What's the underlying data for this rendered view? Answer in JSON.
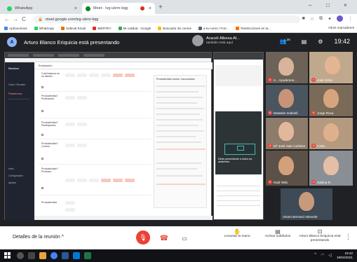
{
  "browser": {
    "tabs": [
      {
        "label": "WhatsApp",
        "favicon_color": "#25d366"
      },
      {
        "label": "Meet - Ivg-ukmr-kqg",
        "favicon_color": "#00832d"
      }
    ],
    "new_tab": "+",
    "window_controls": [
      "–",
      "□",
      "×"
    ],
    "url": "meet.google.com/ivg-ukmr-kqg",
    "nav": [
      "←",
      "→",
      "C"
    ],
    "bookmarks": [
      {
        "label": "Aplicaciones",
        "color": "#4285f4"
      },
      {
        "label": "WhatsApp",
        "color": "#25d366"
      },
      {
        "label": "Safeval Email",
        "color": "#e37400"
      },
      {
        "label": "WERTEY",
        "color": "#d93025"
      },
      {
        "label": "Mi calidad - Google",
        "color": "#34a853"
      },
      {
        "label": "Buscador de cursos",
        "color": "#fbbc04"
      },
      {
        "label": "a·tu-curso / Forr...",
        "color": "#5f6368"
      },
      {
        "label": "Restricciones en la...",
        "color": "#ff6d00"
      }
    ],
    "bookmarks_right": "Otros marcadores"
  },
  "meet": {
    "presenting_banner": "Arturo Blanco Eriquicia está presentando",
    "presenter_initial": "A",
    "joiner": {
      "name": "Araceli Albesa Al...",
      "status": "también está aquí"
    },
    "people_count": "25",
    "time": "19:42",
    "shared_screen": {
      "brand": "Biscitam",
      "side_section": "Clase / Reunión",
      "side_active": "Plataforma",
      "side_items": [
        "Inicio",
        "Configuración",
        "Ajustes"
      ],
      "header_label": "Evaluación",
      "rows": [
        {
          "label": "Cual balanza es un diseño"
        },
        {
          "label": "Productividad / Puntuación"
        },
        {
          "label": "Productividad / Participación"
        },
        {
          "label": "Productividad / Control"
        },
        {
          "label": "Productividad / Producto"
        },
        {
          "label": "Productividad"
        }
      ],
      "right_panel_title": "Productividad varios / escuchados"
    },
    "middle_panel_caption": "Estás presentando a todos los asistentes",
    "participants": [
      {
        "name": "ri... Ayudemos...",
        "muted": true
      },
      {
        "name": "José Girón",
        "muted": true
      },
      {
        "name": "Mutasim Gabrieli",
        "muted": true
      },
      {
        "name": "Jorge Roca",
        "muted": true
      },
      {
        "name": "Mº José Sale Cañeles",
        "muted": true
      },
      {
        "name": "Carla...",
        "muted": true
      },
      {
        "name": "Raúl Tello",
        "muted": true
      },
      {
        "name": "Sabina R.",
        "muted": true
      },
      {
        "name": "Alvaro Bernard Valverde",
        "muted": false
      }
    ]
  },
  "bottom_bar": {
    "meeting_details": "Detalles de la reunión",
    "raise_hand": "Levantar la mano",
    "captions": "Activar subtítulos",
    "presenting": "Arturo Blanco Eriquicia está presentando",
    "more": "⋮"
  },
  "taskbar": {
    "time": "19:42",
    "date": "19/04/2021"
  }
}
